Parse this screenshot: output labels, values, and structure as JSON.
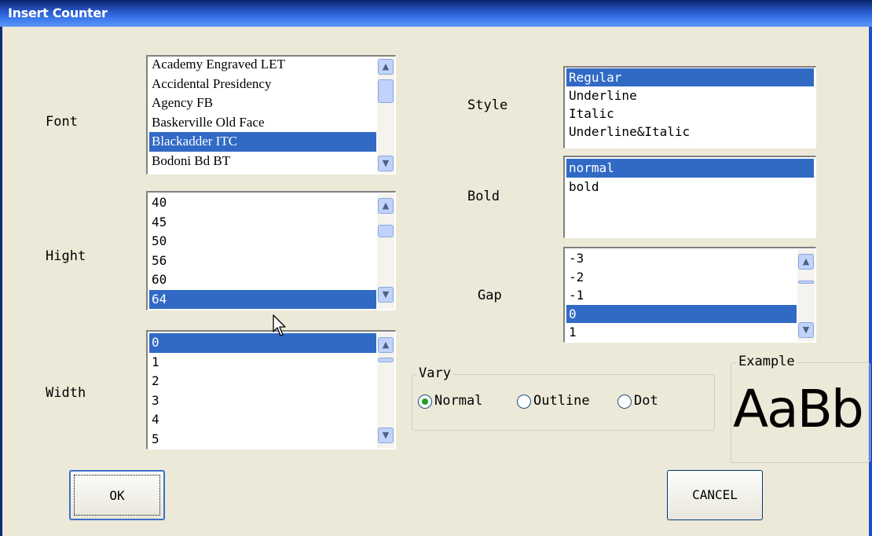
{
  "window": {
    "title": "Insert Counter"
  },
  "font": {
    "label": "Font",
    "options": [
      "Academy Engraved LET",
      "Accidental Presidency",
      "Agency FB",
      "Baskerville Old Face",
      "Blackadder ITC",
      "Bodoni Bd BT"
    ],
    "selected": "Blackadder ITC"
  },
  "height": {
    "label": "Hight",
    "options": [
      "40",
      "45",
      "50",
      "56",
      "60",
      "64"
    ],
    "selected": "64"
  },
  "width": {
    "label": "Width",
    "options": [
      "0",
      "1",
      "2",
      "3",
      "4",
      "5"
    ],
    "selected": "0"
  },
  "style": {
    "label": "Style",
    "options": [
      "Regular",
      "Underline",
      "Italic",
      "Underline&Italic"
    ],
    "selected": "Regular"
  },
  "bold": {
    "label": "Bold",
    "options": [
      "normal",
      "bold"
    ],
    "selected": "normal"
  },
  "gap": {
    "label": "Gap",
    "options": [
      "-3",
      "-2",
      "-1",
      "0",
      "1"
    ],
    "selected": "0"
  },
  "vary": {
    "legend": "Vary",
    "options": [
      "Normal",
      "Outline",
      "Dot"
    ],
    "selected": "Normal"
  },
  "example": {
    "legend": "Example",
    "text": "AaBb"
  },
  "buttons": {
    "ok": "OK",
    "cancel": "CANCEL"
  },
  "icons": {
    "scroll_up": "chevron-up-icon",
    "scroll_down": "chevron-down-icon",
    "cursor": "mouse-pointer-icon"
  }
}
